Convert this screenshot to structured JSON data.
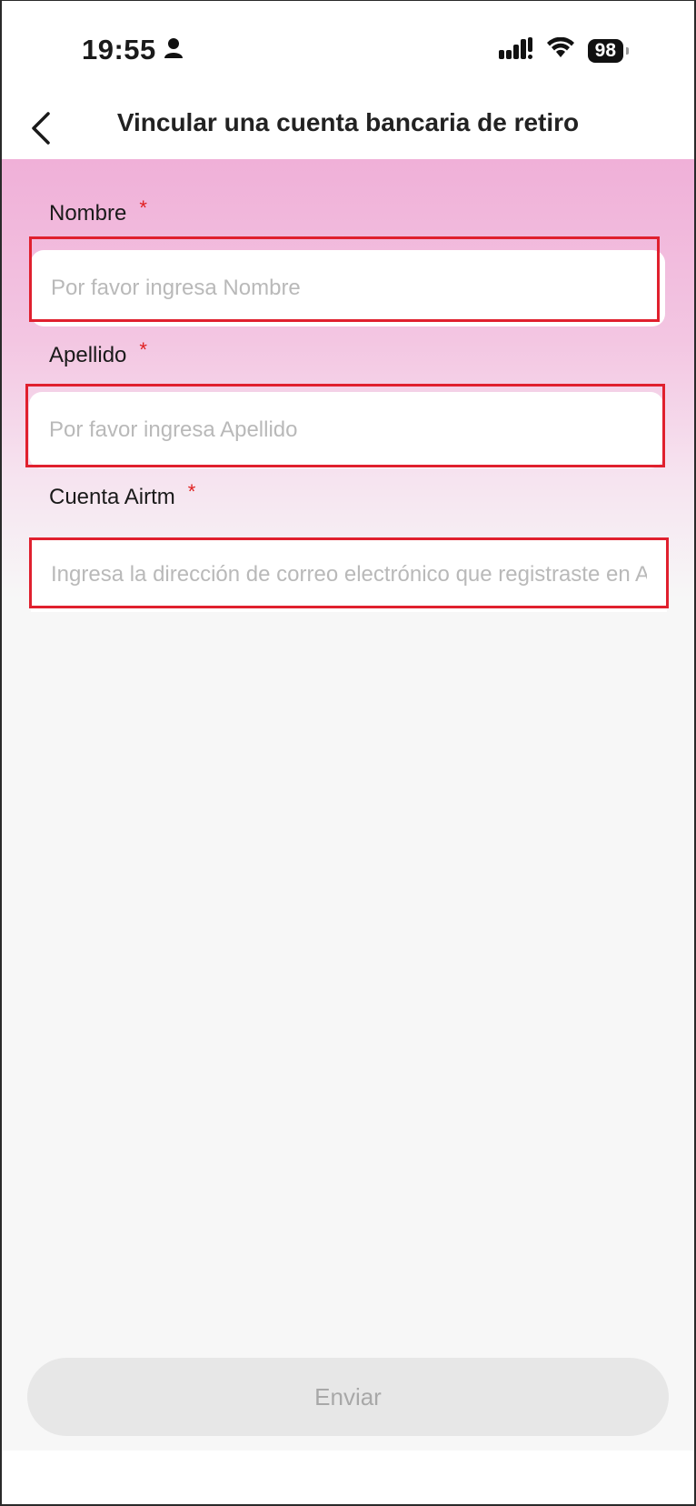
{
  "status_bar": {
    "time": "19:55",
    "battery": "98",
    "person_icon": "person-icon",
    "signal_icon": "cellular-signal-icon",
    "wifi_icon": "wifi-icon"
  },
  "nav": {
    "back_icon": "chevron-left-icon",
    "title": "Vincular una cuenta bancaria de retiro"
  },
  "form": {
    "first_name": {
      "label": "Nombre",
      "required_mark": "*",
      "placeholder": "Por favor ingresa Nombre",
      "value": ""
    },
    "last_name": {
      "label": "Apellido",
      "required_mark": "*",
      "placeholder": "Por favor ingresa Apellido",
      "value": ""
    },
    "airtm_account": {
      "label": "Cuenta Airtm",
      "required_mark": "*",
      "placeholder": "Ingresa la dirección de correo electrónico que registraste en Airtm",
      "value": ""
    }
  },
  "submit": {
    "label": "Enviar"
  },
  "colors": {
    "accent_gradient_top": "#f0b0d8",
    "required": "#e02020",
    "highlight_box": "#e0202e",
    "button_disabled_bg": "#e7e7e7",
    "button_disabled_text": "#a8a8a8"
  }
}
